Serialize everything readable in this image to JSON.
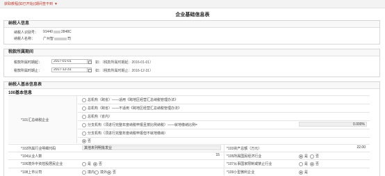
{
  "topbar": {
    "link": "获取教程(如已开始)(期间查不到",
    "caret": "▼"
  },
  "page_title": "企业基础信息表",
  "taxpayer": {
    "header": "纳税人信息",
    "id_label": "纳税人识别号：",
    "id_prefix": "91440",
    "id_suffix": "2848C",
    "name_label": "纳税人名称：",
    "name_prefix": "广州智",
    "name_suffix": "司"
  },
  "period": {
    "header": "税款所属期间",
    "start_label": "税款所属时期起：",
    "start_value": "2017-01-01",
    "start_hint": "如：（税款所属时期起：2016-01-01）",
    "end_label": "税款所属时期止：",
    "end_value": "2017-12-31",
    "end_hint": "如：（税款所属时期止：2016-12-31）"
  },
  "basic": {
    "header": "纳税人基本信息表",
    "subheader": "100基本信息",
    "row101_label": "*101汇总纳税企业",
    "options": [
      "总机构（跨省）——适用《跨地区经营汇总纳税管理办法》",
      "总机构（跨省）——不适用《跨地区经营汇总纳税管理办法》",
      "总机构（省内）",
      "分支机构（须进行完整年度纳税申报且按比例纳税）——就地缴纳比例=",
      "分支机构（须进行完整年度纳税申报但不就地缴纳）",
      "否"
    ],
    "ratio_value": "0.000%",
    "row102_label": "*102所属行业明细代码",
    "row102_value": "其他未列明批发业",
    "row103_label": "*103资产总额（万元）",
    "row103_value": "22.00",
    "row104_label": "*104从业人数",
    "row104_value": "15",
    "row105_label": "*105所属国民经济行业",
    "row105_yes": "是",
    "row105_no": "否",
    "row106_label": "*106境外中资控股居民企业",
    "row106_yes": "是",
    "row106_no": "否",
    "row107_label": "*107从事国家限制或禁止行业",
    "row107_yes": "是",
    "row107_no": "否",
    "row108_label": "*108上市公司",
    "row108_opt1": "境内",
    "row108_opt2": "境外",
    "row108_opt3": "否",
    "row109_label": "*109小型微利企业",
    "row109_yes": "是"
  }
}
